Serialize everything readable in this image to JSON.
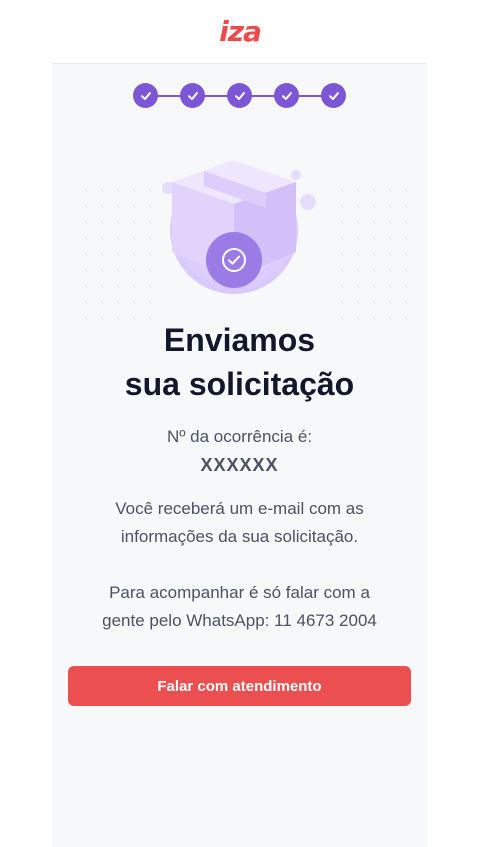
{
  "brand": {
    "logo_text": "iza",
    "accent_color": "#ec4b4b",
    "step_color": "#7b57d6"
  },
  "stepper": {
    "total_steps": 5,
    "completed_steps": 5,
    "step_icon": "check-icon"
  },
  "illustration": {
    "icon": "package-box-icon",
    "badge_icon": "check-circle-icon"
  },
  "content": {
    "title_line1": "Enviamos",
    "title_line2": "sua solicitação",
    "occurrence_label": "Nº da ocorrência é:",
    "occurrence_value": "XXXXXX",
    "email_line1": "Você receberá um e-mail com as",
    "email_line2": "informações da sua solicitação.",
    "whatsapp_line1": "Para acompanhar é só falar com a",
    "whatsapp_line2": "gente pelo WhatsApp: 11 4673 2004"
  },
  "cta": {
    "label": "Falar com atendimento"
  }
}
